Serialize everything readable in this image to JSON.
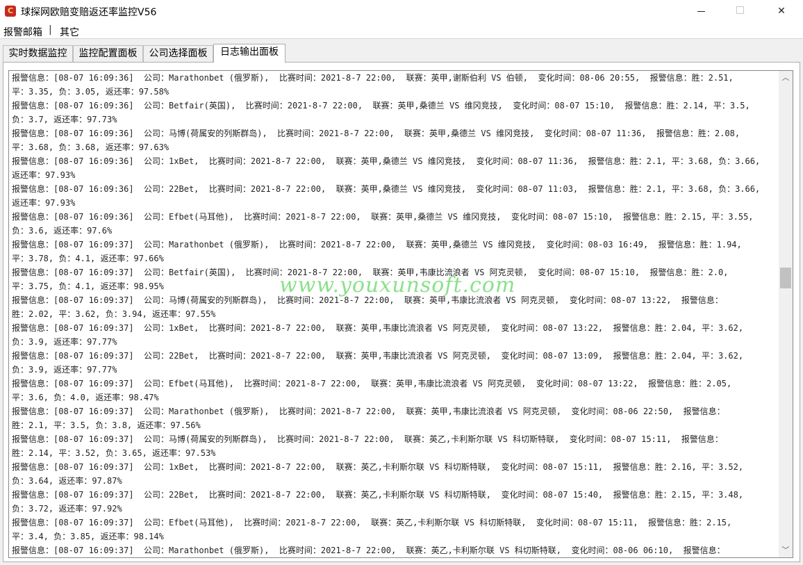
{
  "window": {
    "title": "球探网欧赔变赔返还率监控V56",
    "icon": "app-logo-icon",
    "controls": {
      "minimize_icon": "minimize-icon",
      "maximize_icon": "maximize-icon",
      "close_icon": "close-icon",
      "close_glyph": "✕"
    }
  },
  "menu": {
    "items": [
      "报警邮箱",
      "其它"
    ],
    "separator": "|"
  },
  "tabs": [
    {
      "label": "实时数据监控",
      "active": false
    },
    {
      "label": "监控配置面板",
      "active": false
    },
    {
      "label": "公司选择面板",
      "active": false
    },
    {
      "label": "日志输出面板",
      "active": true
    }
  ],
  "log": {
    "lines": [
      "报警信息：[08-07 16:09:36]  公司：Marathonbet (俄罗斯),  比赛时间：2021-8-7 22:00,  联赛：英甲,谢斯伯利 VS 伯顿,  变化时间：08-06 20:55,  报警信息：胜：2.51,",
      "平：3.35, 负：3.05, 返还率：97.58%",
      "报警信息：[08-07 16:09:36]  公司：Betfair(英国),  比赛时间：2021-8-7 22:00,  联赛：英甲,桑德兰 VS 维冈竞技,  变化时间：08-07 15:10,  报警信息：胜：2.14, 平：3.5,",
      "负：3.7, 返还率：97.73%",
      "报警信息：[08-07 16:09:36]  公司：马博(荷属安的列斯群岛),  比赛时间：2021-8-7 22:00,  联赛：英甲,桑德兰 VS 维冈竞技,  变化时间：08-07 11:36,  报警信息：胜：2.08,",
      "平：3.68, 负：3.68, 返还率：97.63%",
      "报警信息：[08-07 16:09:36]  公司：1xBet,  比赛时间：2021-8-7 22:00,  联赛：英甲,桑德兰 VS 维冈竞技,  变化时间：08-07 11:36,  报警信息：胜：2.1, 平：3.68, 负：3.66,",
      "返还率：97.93%",
      "报警信息：[08-07 16:09:36]  公司：22Bet,  比赛时间：2021-8-7 22:00,  联赛：英甲,桑德兰 VS 维冈竞技,  变化时间：08-07 11:03,  报警信息：胜：2.1, 平：3.68, 负：3.66,",
      "返还率：97.93%",
      "报警信息：[08-07 16:09:36]  公司：Efbet(马耳他),  比赛时间：2021-8-7 22:00,  联赛：英甲,桑德兰 VS 维冈竞技,  变化时间：08-07 15:10,  报警信息：胜：2.15, 平：3.55,",
      "负：3.6, 返还率：97.6%",
      "报警信息：[08-07 16:09:37]  公司：Marathonbet (俄罗斯),  比赛时间：2021-8-7 22:00,  联赛：英甲,桑德兰 VS 维冈竞技,  变化时间：08-03 16:49,  报警信息：胜：1.94,",
      "平：3.78, 负：4.1, 返还率：97.66%",
      "报警信息：[08-07 16:09:37]  公司：Betfair(英国),  比赛时间：2021-8-7 22:00,  联赛：英甲,韦康比流浪者 VS 阿克灵顿,  变化时间：08-07 15:10,  报警信息：胜：2.0,",
      "平：3.75, 负：4.1, 返还率：98.95%",
      "报警信息：[08-07 16:09:37]  公司：马博(荷属安的列斯群岛),  比赛时间：2021-8-7 22:00,  联赛：英甲,韦康比流浪者 VS 阿克灵顿,  变化时间：08-07 13:22,  报警信息：",
      "胜：2.02, 平：3.62, 负：3.94, 返还率：97.55%",
      "报警信息：[08-07 16:09:37]  公司：1xBet,  比赛时间：2021-8-7 22:00,  联赛：英甲,韦康比流浪者 VS 阿克灵顿,  变化时间：08-07 13:22,  报警信息：胜：2.04, 平：3.62,",
      "负：3.9, 返还率：97.77%",
      "报警信息：[08-07 16:09:37]  公司：22Bet,  比赛时间：2021-8-7 22:00,  联赛：英甲,韦康比流浪者 VS 阿克灵顿,  变化时间：08-07 13:09,  报警信息：胜：2.04, 平：3.62,",
      "负：3.9, 返还率：97.77%",
      "报警信息：[08-07 16:09:37]  公司：Efbet(马耳他),  比赛时间：2021-8-7 22:00,  联赛：英甲,韦康比流浪者 VS 阿克灵顿,  变化时间：08-07 13:22,  报警信息：胜：2.05,",
      "平：3.6, 负：4.0, 返还率：98.47%",
      "报警信息：[08-07 16:09:37]  公司：Marathonbet (俄罗斯),  比赛时间：2021-8-7 22:00,  联赛：英甲,韦康比流浪者 VS 阿克灵顿,  变化时间：08-06 22:50,  报警信息：",
      "胜：2.1, 平：3.5, 负：3.8, 返还率：97.56%",
      "报警信息：[08-07 16:09:37]  公司：马博(荷属安的列斯群岛),  比赛时间：2021-8-7 22:00,  联赛：英乙,卡利斯尔联 VS 科切斯特联,  变化时间：08-07 15:11,  报警信息：",
      "胜：2.14, 平：3.52, 负：3.65, 返还率：97.53%",
      "报警信息：[08-07 16:09:37]  公司：1xBet,  比赛时间：2021-8-7 22:00,  联赛：英乙,卡利斯尔联 VS 科切斯特联,  变化时间：08-07 15:11,  报警信息：胜：2.16, 平：3.52,",
      "负：3.64, 返还率：97.87%",
      "报警信息：[08-07 16:09:37]  公司：22Bet,  比赛时间：2021-8-7 22:00,  联赛：英乙,卡利斯尔联 VS 科切斯特联,  变化时间：08-07 15:40,  报警信息：胜：2.15, 平：3.48,",
      "负：3.72, 返还率：97.92%",
      "报警信息：[08-07 16:09:37]  公司：Efbet(马耳他),  比赛时间：2021-8-7 22:00,  联赛：英乙,卡利斯尔联 VS 科切斯特联,  变化时间：08-07 15:11,  报警信息：胜：2.15,",
      "平：3.4, 负：3.85, 返还率：98.14%",
      "报警信息：[08-07 16:09:37]  公司：Marathonbet (俄罗斯),  比赛时间：2021-8-7 22:00,  联赛：英乙,卡利斯尔联 VS 科切斯特联,  变化时间：08-06 06:10,  报警信息："
    ]
  },
  "scrollbar": {
    "up_icon": "scroll-up-arrow-icon",
    "down_icon": "scroll-down-arrow-icon",
    "up_glyph": "︿",
    "down_glyph": "﹀"
  },
  "watermark": "www.youxunsoft.com"
}
